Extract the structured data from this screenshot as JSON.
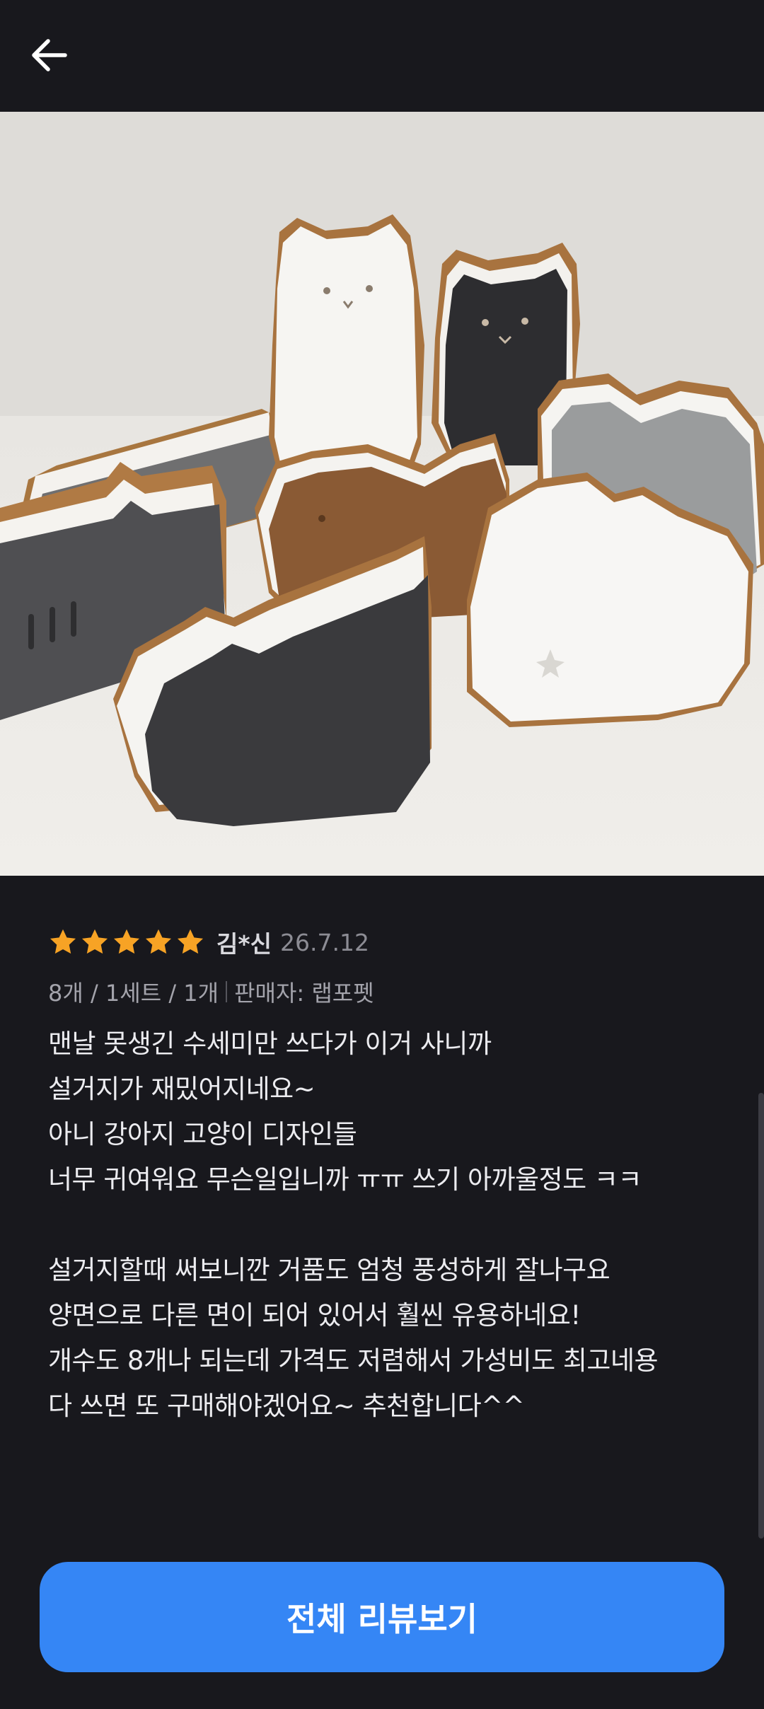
{
  "header": {
    "back_icon": "arrow-left-icon"
  },
  "photo": {
    "carousel_count": 4,
    "active_index": 0,
    "accent_color": "#3d8cf5"
  },
  "review": {
    "rating": 5,
    "max_rating": 5,
    "star_color": "#f7a325",
    "reviewer": "김*신",
    "date": "26.7.12",
    "option": "8개 / 1세트 / 1개",
    "seller": "판매자: 랩포펫",
    "body": "맨날 못생긴 수세미만 쓰다가 이거 사니까\n설거지가 재밌어지네요~\n아니 강아지 고양이 디자인들\n너무 귀여워요 무슨일입니까 ㅠㅠ 쓰기 아까울정도 ㅋㅋ\n\n설거지할때 써보니깐 거품도 엄청 풍성하게 잘나구요\n양면으로 다른 면이 되어 있어서 훨씬 유용하네요!\n개수도 8개나 되는데 가격도 저렴해서 가성비도 최고네용\n다 쓰면 또 구매해야겠어요~ 추천합니다^^"
  },
  "footer": {
    "cta_label": "전체 리뷰보기",
    "cta_color": "#3586f5"
  }
}
